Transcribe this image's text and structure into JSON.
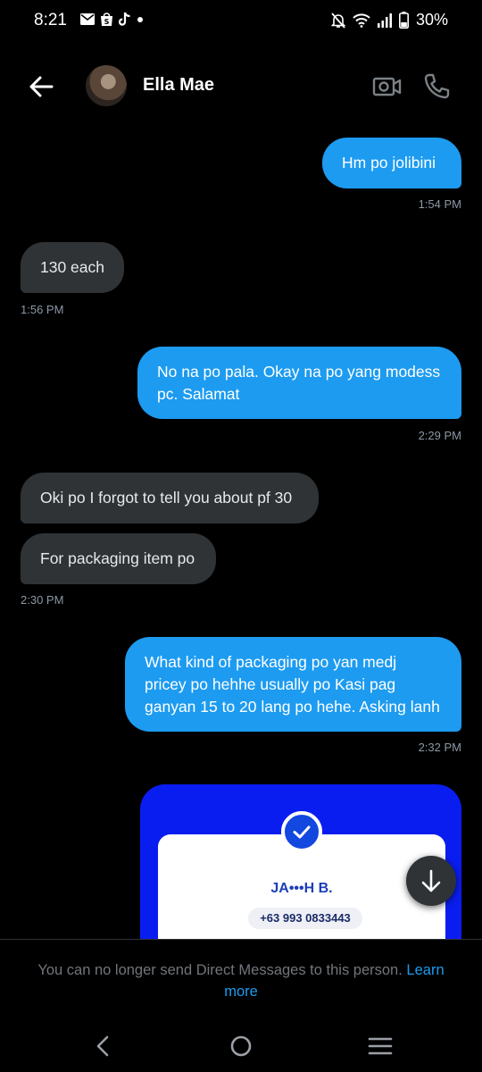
{
  "status_bar": {
    "time": "8:21",
    "battery": "30%",
    "left_icons": [
      "mail-icon",
      "shopee-icon",
      "tiktok-icon",
      "dot-icon"
    ],
    "right_icons": [
      "mute-icon",
      "wifi-icon",
      "signal-icon",
      "battery-icon"
    ]
  },
  "header": {
    "contact_name": "Ella Mae"
  },
  "messages": [
    {
      "side": "out",
      "text": "Hm po jolibini",
      "time": "1:54 PM"
    },
    {
      "side": "in",
      "text": "130 each",
      "time": "1:56 PM"
    },
    {
      "side": "out",
      "text": "No na po pala. Okay na po yang modess pc. Salamat",
      "time": "2:29 PM"
    },
    {
      "side": "in",
      "text": "Oki po I forgot to tell you about pf 30"
    },
    {
      "side": "in",
      "text": "For packaging item po",
      "time": "2:30 PM"
    },
    {
      "side": "out",
      "text": "What kind of packaging po yan medj pricey po hehhe usually po Kasi pag ganyan 15 to 20 lang po hehe. Asking lanh",
      "time": "2:32 PM"
    }
  ],
  "image_card": {
    "name": "JA•••H B.",
    "phone": "+63 993 0833443"
  },
  "footer": {
    "notice": "You can no longer send Direct Messages to this person.",
    "link": "Learn more"
  },
  "colors": {
    "accent": "#1d9bf0",
    "incoming_bubble": "#2f3336",
    "background": "#000000",
    "card_blue": "#0a1df0"
  }
}
